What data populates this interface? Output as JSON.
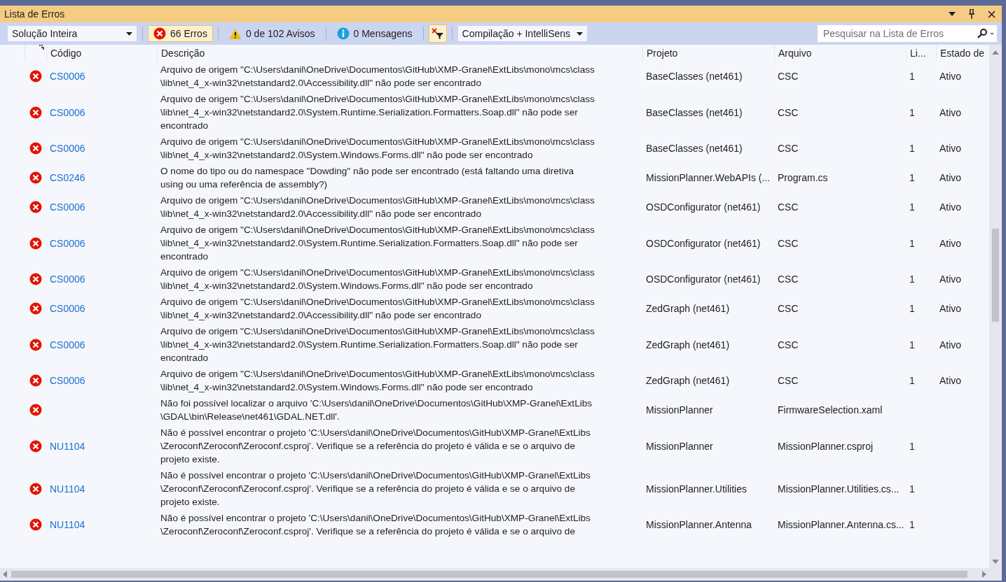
{
  "window": {
    "title": "Lista de Erros"
  },
  "toolbar": {
    "scope": {
      "value": "Solução Inteira"
    },
    "filters": [
      {
        "kind": "errors",
        "label": "66 Erros",
        "selected": true
      },
      {
        "kind": "warnings",
        "label": "0 de 102 Avisos",
        "selected": false
      },
      {
        "kind": "messages",
        "label": "0 Mensagens",
        "selected": false
      }
    ],
    "filter_toggle": {
      "selected": true
    },
    "build_source": {
      "value": "Compilação + IntelliSens"
    },
    "search": {
      "placeholder": "Pesquisar na Lista de Erros"
    }
  },
  "table": {
    "columns": [
      "Código",
      "Descrição",
      "Projeto",
      "Arquivo",
      "Li...",
      "Estado de"
    ],
    "rows": [
      {
        "kind": "error",
        "code": "CS0006",
        "description": [
          "Arquivo de origem \"C:\\Users\\danil\\OneDrive\\Documentos\\GitHub\\XMP-Granel\\ExtLibs\\mono\\mcs\\class",
          "\\lib\\net_4_x-win32\\netstandard2.0\\Accessibility.dll\" não pode ser encontrado"
        ],
        "project": "BaseClasses (net461)",
        "file": "CSC",
        "line": "1",
        "state": "Ativo"
      },
      {
        "kind": "error",
        "code": "CS0006",
        "description": [
          "Arquivo de origem \"C:\\Users\\danil\\OneDrive\\Documentos\\GitHub\\XMP-Granel\\ExtLibs\\mono\\mcs\\class",
          "\\lib\\net_4_x-win32\\netstandard2.0\\System.Runtime.Serialization.Formatters.Soap.dll\" não pode ser",
          "encontrado"
        ],
        "project": "BaseClasses (net461)",
        "file": "CSC",
        "line": "1",
        "state": "Ativo"
      },
      {
        "kind": "error",
        "code": "CS0006",
        "description": [
          "Arquivo de origem \"C:\\Users\\danil\\OneDrive\\Documentos\\GitHub\\XMP-Granel\\ExtLibs\\mono\\mcs\\class",
          "\\lib\\net_4_x-win32\\netstandard2.0\\System.Windows.Forms.dll\" não pode ser encontrado"
        ],
        "project": "BaseClasses (net461)",
        "file": "CSC",
        "line": "1",
        "state": "Ativo"
      },
      {
        "kind": "error",
        "code": "CS0246",
        "description": [
          "O nome do tipo ou do namespace \"Dowding\" não pode ser encontrado (está faltando uma diretiva",
          "using ou uma referência de assembly?)"
        ],
        "project": "MissionPlanner.WebAPIs (...",
        "file": "Program.cs",
        "line": "1",
        "state": "Ativo"
      },
      {
        "kind": "error",
        "code": "CS0006",
        "description": [
          "Arquivo de origem \"C:\\Users\\danil\\OneDrive\\Documentos\\GitHub\\XMP-Granel\\ExtLibs\\mono\\mcs\\class",
          "\\lib\\net_4_x-win32\\netstandard2.0\\Accessibility.dll\" não pode ser encontrado"
        ],
        "project": "OSDConfigurator (net461)",
        "file": "CSC",
        "line": "1",
        "state": "Ativo"
      },
      {
        "kind": "error",
        "code": "CS0006",
        "description": [
          "Arquivo de origem \"C:\\Users\\danil\\OneDrive\\Documentos\\GitHub\\XMP-Granel\\ExtLibs\\mono\\mcs\\class",
          "\\lib\\net_4_x-win32\\netstandard2.0\\System.Runtime.Serialization.Formatters.Soap.dll\" não pode ser",
          "encontrado"
        ],
        "project": "OSDConfigurator (net461)",
        "file": "CSC",
        "line": "1",
        "state": "Ativo"
      },
      {
        "kind": "error",
        "code": "CS0006",
        "description": [
          "Arquivo de origem \"C:\\Users\\danil\\OneDrive\\Documentos\\GitHub\\XMP-Granel\\ExtLibs\\mono\\mcs\\class",
          "\\lib\\net_4_x-win32\\netstandard2.0\\System.Windows.Forms.dll\" não pode ser encontrado"
        ],
        "project": "OSDConfigurator (net461)",
        "file": "CSC",
        "line": "1",
        "state": "Ativo"
      },
      {
        "kind": "error",
        "code": "CS0006",
        "description": [
          "Arquivo de origem \"C:\\Users\\danil\\OneDrive\\Documentos\\GitHub\\XMP-Granel\\ExtLibs\\mono\\mcs\\class",
          "\\lib\\net_4_x-win32\\netstandard2.0\\Accessibility.dll\" não pode ser encontrado"
        ],
        "project": "ZedGraph (net461)",
        "file": "CSC",
        "line": "1",
        "state": "Ativo"
      },
      {
        "kind": "error",
        "code": "CS0006",
        "description": [
          "Arquivo de origem \"C:\\Users\\danil\\OneDrive\\Documentos\\GitHub\\XMP-Granel\\ExtLibs\\mono\\mcs\\class",
          "\\lib\\net_4_x-win32\\netstandard2.0\\System.Runtime.Serialization.Formatters.Soap.dll\" não pode ser",
          "encontrado"
        ],
        "project": "ZedGraph (net461)",
        "file": "CSC",
        "line": "1",
        "state": "Ativo"
      },
      {
        "kind": "error",
        "code": "CS0006",
        "description": [
          "Arquivo de origem \"C:\\Users\\danil\\OneDrive\\Documentos\\GitHub\\XMP-Granel\\ExtLibs\\mono\\mcs\\class",
          "\\lib\\net_4_x-win32\\netstandard2.0\\System.Windows.Forms.dll\" não pode ser encontrado"
        ],
        "project": "ZedGraph (net461)",
        "file": "CSC",
        "line": "1",
        "state": "Ativo"
      },
      {
        "kind": "error",
        "description": [
          "Não foi possível localizar o arquivo 'C:\\Users\\danil\\OneDrive\\Documentos\\GitHub\\XMP-Granel\\ExtLibs",
          "\\GDAL\\bin\\Release\\net461\\GDAL.NET.dll'."
        ],
        "project": "MissionPlanner",
        "file": "FirmwareSelection.xaml"
      },
      {
        "kind": "error",
        "code": "NU1104",
        "description": [
          "Não é possível encontrar o projeto 'C:\\Users\\danil\\OneDrive\\Documentos\\GitHub\\XMP-Granel\\ExtLibs",
          "\\Zeroconf\\Zeroconf\\Zeroconf.csproj'. Verifique se a referência do projeto é válida e se o arquivo de",
          "projeto existe."
        ],
        "project": "MissionPlanner",
        "file": "MissionPlanner.csproj",
        "line": "1"
      },
      {
        "kind": "error",
        "code": "NU1104",
        "description": [
          "Não é possível encontrar o projeto 'C:\\Users\\danil\\OneDrive\\Documentos\\GitHub\\XMP-Granel\\ExtLibs",
          "\\Zeroconf\\Zeroconf\\Zeroconf.csproj'. Verifique se a referência do projeto é válida e se o arquivo de",
          "projeto existe."
        ],
        "project": "MissionPlanner.Utilities",
        "file": "MissionPlanner.Utilities.cs...",
        "line": "1"
      },
      {
        "kind": "error",
        "code": "NU1104",
        "description": [
          "Não é possível encontrar o projeto 'C:\\Users\\danil\\OneDrive\\Documentos\\GitHub\\XMP-Granel\\ExtLibs",
          "\\Zeroconf\\Zeroconf\\Zeroconf.csproj'. Verifique se a referência do projeto é válida e se o arquivo de"
        ],
        "project": "MissionPlanner.Antenna",
        "file": "MissionPlanner.Antenna.cs...",
        "line": "1"
      }
    ]
  }
}
